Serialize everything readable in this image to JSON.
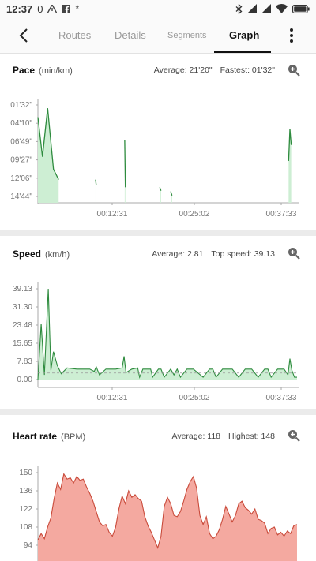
{
  "status": {
    "time": "12:37",
    "count": "0"
  },
  "tabs": [
    {
      "label": "Routes"
    },
    {
      "label": "Details"
    },
    {
      "label": "Segments"
    },
    {
      "label": "Graph"
    }
  ],
  "pace": {
    "title": "Pace",
    "unit": "(min/km)",
    "average": "Average: 21'20\"",
    "fastest": "Fastest: 01'32\""
  },
  "speed": {
    "title": "Speed",
    "unit": "(km/h)",
    "average": "Average: 2.81",
    "top": "Top speed: 39.13"
  },
  "heart": {
    "title": "Heart rate",
    "unit": "(BPM)",
    "average": "Average: 118",
    "highest": "Highest: 148"
  },
  "chart_data": [
    {
      "type": "area",
      "name": "pace",
      "y_tick_labels": [
        "01'32\"",
        "04'10\"",
        "06'49\"",
        "09'27\"",
        "12'06\"",
        "14'44\""
      ],
      "x_tick_labels": [
        "00:12:31",
        "00:25:02",
        "00:37:33"
      ],
      "xlim_minutes": [
        0,
        40
      ],
      "segments": [
        {
          "x": [
            0.0,
            0.7,
            1.5,
            2.4,
            3.2
          ],
          "y_minutes": [
            3.3,
            9.0,
            2.0,
            10.8,
            12.3
          ]
        },
        {
          "x": [
            8.9,
            9.0
          ],
          "y_minutes": [
            12.3,
            13.1
          ]
        },
        {
          "x": [
            13.4,
            13.5
          ],
          "y_minutes": [
            6.6,
            13.4
          ]
        },
        {
          "x": [
            18.8,
            19.0
          ],
          "y_minutes": [
            13.4,
            13.9
          ]
        },
        {
          "x": [
            20.5,
            20.7
          ],
          "y_minutes": [
            14.0,
            14.6
          ]
        },
        {
          "x": [
            38.7,
            38.9,
            39.1
          ],
          "y_minutes": [
            9.6,
            5.0,
            7.3
          ]
        }
      ],
      "color": "#2e8b3e",
      "fill": "#cdeed3"
    },
    {
      "type": "area",
      "name": "speed",
      "y_ticks": [
        0.0,
        7.83,
        15.65,
        23.48,
        31.3,
        39.13
      ],
      "x_tick_labels": [
        "00:12:31",
        "00:25:02",
        "00:37:33"
      ],
      "xlim_minutes": [
        0,
        40
      ],
      "average_line": 2.81,
      "x": [
        0.0,
        0.5,
        1.0,
        1.6,
        2.0,
        2.4,
        3.0,
        3.6,
        4.5,
        6.0,
        8.0,
        8.7,
        9.0,
        9.5,
        10.5,
        12.0,
        13.0,
        13.3,
        13.6,
        14.5,
        15.4,
        15.7,
        16.2,
        17.4,
        17.7,
        18.6,
        19.0,
        19.5,
        20.5,
        21.0,
        21.5,
        22.0,
        23.0,
        24.0,
        25.5,
        26.5,
        27.0,
        27.5,
        28.5,
        29.0,
        30.0,
        31.0,
        32.0,
        33.0,
        34.0,
        35.0,
        35.5,
        36.0,
        37.0,
        38.0,
        38.6,
        38.9,
        39.2,
        39.6,
        40.0
      ],
      "y": [
        0.0,
        24.0,
        2.0,
        39.13,
        4.0,
        12.0,
        6.0,
        2.5,
        5.0,
        4.5,
        4.5,
        3.5,
        5.5,
        2.0,
        4.5,
        4.5,
        5.0,
        10.0,
        3.0,
        4.5,
        5.0,
        1.0,
        4.5,
        4.5,
        1.0,
        4.5,
        4.5,
        1.0,
        4.5,
        2.0,
        4.5,
        1.0,
        4.5,
        4.5,
        1.0,
        4.5,
        4.5,
        1.0,
        4.5,
        4.5,
        4.5,
        1.0,
        4.5,
        4.5,
        1.0,
        4.5,
        4.5,
        1.0,
        4.5,
        4.5,
        2.0,
        9.0,
        4.0,
        1.0,
        1.0
      ],
      "color": "#2e8b3e",
      "fill": "#cdeed3"
    },
    {
      "type": "area",
      "name": "heart_rate",
      "y_ticks": [
        94,
        108,
        122,
        136,
        150
      ],
      "xlim_minutes": [
        0,
        40
      ],
      "average_line": 118,
      "x": [
        0,
        0.5,
        1,
        1.5,
        2,
        2.5,
        3,
        3.5,
        4,
        4.5,
        5,
        5.5,
        6,
        6.5,
        7,
        7.5,
        8,
        8.5,
        9,
        9.5,
        10,
        10.5,
        11,
        11.5,
        12,
        12.5,
        13,
        13.5,
        14,
        14.5,
        15,
        15.5,
        16,
        16.5,
        17,
        17.5,
        18,
        18.5,
        19,
        19.5,
        20,
        20.5,
        21,
        21.5,
        22,
        22.5,
        23,
        23.5,
        24,
        24.5,
        25,
        25.5,
        26,
        26.5,
        27,
        27.5,
        28,
        28.5,
        29,
        29.5,
        30,
        30.5,
        31,
        31.5,
        32,
        32.5,
        33,
        33.5,
        34,
        34.5,
        35,
        35.5,
        36,
        36.5,
        37,
        37.5,
        38,
        38.5,
        39,
        39.5,
        40
      ],
      "y": [
        98,
        103,
        99,
        108,
        115,
        130,
        142,
        137,
        149,
        145,
        146,
        142,
        147,
        144,
        145,
        139,
        134,
        128,
        120,
        112,
        109,
        110,
        104,
        101,
        108,
        122,
        132,
        126,
        136,
        131,
        133,
        130,
        128,
        116,
        109,
        104,
        98,
        92,
        101,
        124,
        131,
        126,
        117,
        116,
        120,
        128,
        137,
        143,
        147,
        138,
        117,
        110,
        116,
        103,
        99,
        101,
        106,
        114,
        124,
        118,
        112,
        117,
        126,
        128,
        123,
        121,
        118,
        122,
        114,
        113,
        111,
        103,
        107,
        108,
        102,
        104,
        101,
        105,
        103,
        109,
        110
      ],
      "color": "#c94a3a",
      "fill": "#f4a9a0"
    }
  ]
}
